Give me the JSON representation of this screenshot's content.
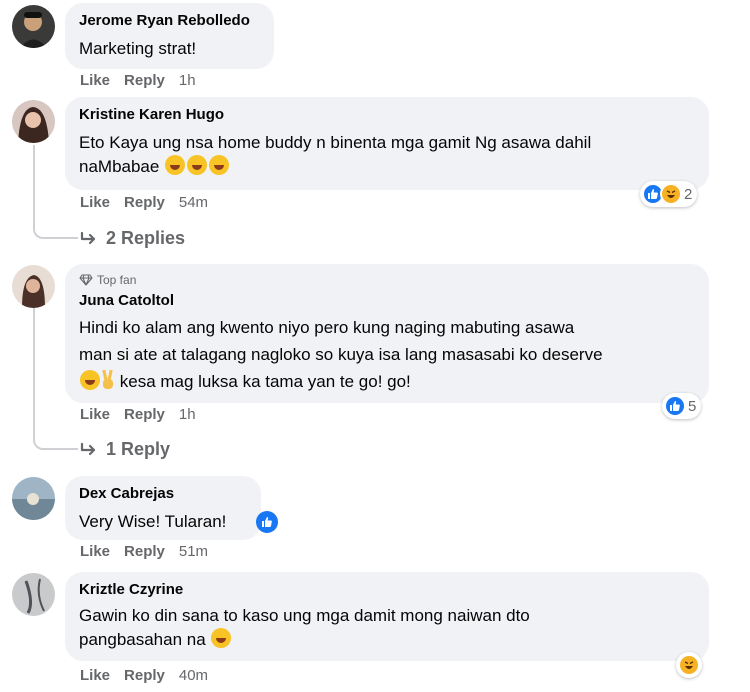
{
  "comments": [
    {
      "author": "Jerome Ryan Rebolledo",
      "text": "Marketing strat!",
      "like_label": "Like",
      "reply_label": "Reply",
      "time": "1h"
    },
    {
      "author": "Kristine Karen Hugo",
      "text_line1": "Eto Kaya ung nsa home buddy n binenta mga gamit Ng asawa dahil",
      "text_line2": "naMbabae",
      "like_label": "Like",
      "reply_label": "Reply",
      "time": "54m",
      "reaction_count": "2",
      "replies_label": "2 Replies"
    },
    {
      "badge": "Top fan",
      "author": "Juna Catoltol",
      "text_line1": "Hindi ko alam ang kwento niyo pero kung naging mabuting asawa",
      "text_line2": "man si ate at talagang nagloko so kuya isa lang masasabi ko deserve",
      "text_line3": "kesa mag luksa ka tama yan te go! go!",
      "like_label": "Like",
      "reply_label": "Reply",
      "time": "1h",
      "reaction_count": "5",
      "replies_label": "1 Reply"
    },
    {
      "author": "Dex Cabrejas",
      "text": "Very Wise! Tularan!",
      "like_label": "Like",
      "reply_label": "Reply",
      "time": "51m"
    },
    {
      "author": "Kriztle Czyrine",
      "text_line1": "Gawin ko din sana to kaso ung mga damit mong naiwan dto",
      "text_line2": "pangbasahan na",
      "like_label": "Like",
      "reply_label": "Reply",
      "time": "40m"
    }
  ],
  "colors": {
    "bubble": "#f0f2f5",
    "like_blue": "#1877f2",
    "haha_yellow": "#f7b125",
    "muted_text": "#65676b"
  },
  "icons": [
    "like-reaction-icon",
    "haha-reaction-icon",
    "laughing-emoji-icon",
    "peace-hand-icon",
    "diamond-icon",
    "reply-arrow-icon"
  ]
}
